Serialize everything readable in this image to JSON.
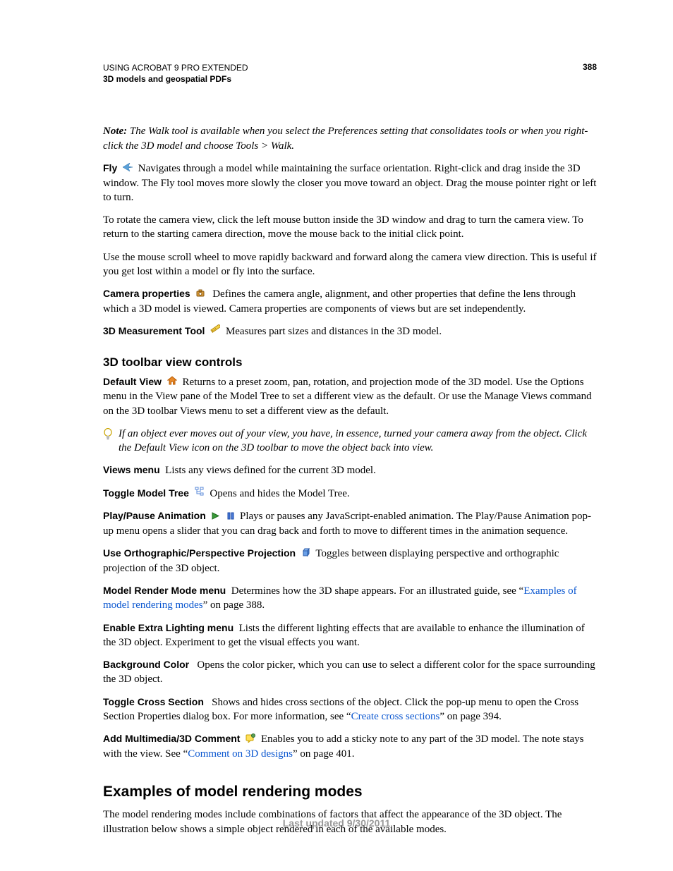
{
  "header": {
    "line1": "USING ACROBAT 9 PRO EXTENDED",
    "line2": "3D models and geospatial PDFs",
    "page": "388"
  },
  "note": {
    "lead": "Note:",
    "text": " The Walk tool is available when you select the Preferences setting that consolidates tools or when you right-click the 3D model and choose Tools > Walk."
  },
  "fly": {
    "term": "Fly",
    "p1": "Navigates through a model while maintaining the surface orientation. Right-click and drag inside the 3D window. The Fly tool moves more slowly the closer you move toward an object. Drag the mouse pointer right or left to turn.",
    "p2": "To rotate the camera view, click the left mouse button inside the 3D window and drag to turn the camera view. To return to the starting camera direction, move the mouse back to the initial click point.",
    "p3": "Use the mouse scroll wheel to move rapidly backward and forward along the camera view direction. This is useful if you get lost within a model or fly into the surface."
  },
  "camprops": {
    "term": "Camera properties",
    "text": "Defines the camera angle, alignment, and other properties that define the lens through which a 3D model is viewed. Camera properties are components of views but are set independently."
  },
  "meas": {
    "term": "3D Measurement Tool",
    "text": "Measures part sizes and distances in the 3D model."
  },
  "h3": "3D toolbar view controls",
  "defview": {
    "term": "Default View",
    "text": "Returns to a preset zoom, pan, rotation, and projection mode of the 3D model. Use the Options menu in the View pane of the Model Tree to set a different view as the default. Or use the Manage Views command on the 3D toolbar Views menu to set a different view as the default."
  },
  "tip": "If an object ever moves out of your view, you have, in essence, turned your camera away from the object. Click the Default View icon on the 3D toolbar to move the object back into view.",
  "views": {
    "term": "Views menu",
    "text": "Lists any views defined for the current 3D model."
  },
  "tree": {
    "term": "Toggle Model Tree",
    "text": "Opens and hides the Model Tree."
  },
  "anim": {
    "term": "Play/Pause Animation",
    "text": "Plays or pauses any JavaScript-enabled animation. The Play/Pause Animation pop-up menu opens a slider that you can drag back and forth to move to different times in the animation sequence."
  },
  "proj": {
    "term": "Use Orthographic/Perspective Projection",
    "text": "Toggles between displaying perspective and orthographic projection of the 3D object."
  },
  "render": {
    "term": "Model Render Mode menu",
    "t1": "Determines how the 3D shape appears. For an illustrated guide, see “",
    "link": "Examples of model rendering modes",
    "t2": "” on page 388."
  },
  "light": {
    "term": "Enable Extra Lighting menu",
    "text": "Lists the different lighting effects that are available to enhance the illumination of the 3D object. Experiment to get the visual effects you want."
  },
  "bg": {
    "term": "Background Color",
    "text": "Opens the color picker, which you can use to select a different color for the space surrounding the 3D object."
  },
  "cross": {
    "term": "Toggle Cross Section",
    "t1": "Shows and hides cross sections of the object. Click the pop-up menu to open the Cross Section Properties dialog box. For more information, see “",
    "link": "Create cross sections",
    "t2": "” on page 394."
  },
  "comment": {
    "term": "Add Multimedia/3D Comment",
    "t1": "Enables you to add a sticky note to any part of the 3D model. The note stays with the view. See “",
    "link": "Comment on 3D designs",
    "t2": "” on page 401."
  },
  "h2": "Examples of model rendering modes",
  "h2p": "The model rendering modes include combinations of factors that affect the appearance of the 3D object. The illustration below shows a simple object rendered in each of the available modes.",
  "footer": "Last updated 9/30/2011"
}
